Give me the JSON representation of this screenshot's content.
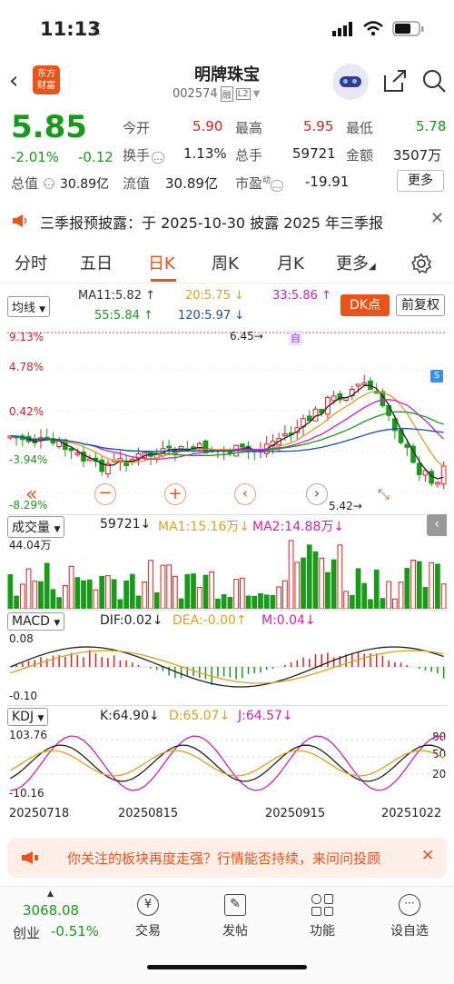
{
  "status": {
    "time": "11:13"
  },
  "header": {
    "brand": "东方\n财富",
    "title": "明牌珠宝",
    "code": "002574",
    "tag1": "融",
    "tag2": "L2"
  },
  "quote": {
    "price": "5.85",
    "pct": "-2.01%",
    "chg": "-0.12",
    "labels": {
      "open": "今开",
      "high": "最高",
      "low": "最低",
      "turnover": "换手",
      "volume": "总手",
      "amount": "金额",
      "mktcap": "总值",
      "float": "流值",
      "pe": "市盈"
    },
    "values": {
      "open": "5.90",
      "high": "5.95",
      "low": "5.78",
      "turnover": "1.13%",
      "volume": "59721",
      "amount": "3507万",
      "mktcap": "30.89亿",
      "float": "30.89亿",
      "pe": "-19.91"
    },
    "more": "更多"
  },
  "notice": {
    "text": "三季报预披露：于 2025-10-30 披露 2025 年三季报"
  },
  "tabs": [
    "分时",
    "五日",
    "日K",
    "周K",
    "月K",
    "更多"
  ],
  "kline": {
    "ma_select": "均线",
    "ma11": "MA11:5.82 ↑",
    "ma20": "20:5.75 ↓",
    "ma33": "33:5.86 ↑",
    "ma55": "55:5.84 ↑",
    "ma120": "120:5.97 ↓",
    "dk": "DK点",
    "adj": "前复权",
    "pct_top": "9.13%",
    "pct_2": "4.78%",
    "pct_3": "0.42%",
    "pct_4": "-3.94%",
    "pct_5": "-8.29%",
    "high_mark": "6.45→",
    "low_mark": "5.42→",
    "marker_zi": "自",
    "marker_s": "S"
  },
  "volume": {
    "select": "成交量",
    "val": "59721↓",
    "ma1": "MA1:15.16万↓",
    "ma2": "MA2:14.88万↓",
    "top": "44.04万"
  },
  "macd": {
    "select": "MACD",
    "dif": "DIF:0.02↓",
    "dea": "DEA:-0.00↑",
    "m": "M:0.04↓",
    "top": "0.08",
    "bottom": "-0.10"
  },
  "kdj": {
    "select": "KDJ",
    "k": "K:64.90↓",
    "d": "D:65.07↓",
    "j": "J:64.57↓",
    "top": "103.76",
    "bottom": "-10.16",
    "r80": "80",
    "r50": "50",
    "r20": "20"
  },
  "dates": [
    "20250718",
    "20250815",
    "20250915",
    "20251022"
  ],
  "banner": {
    "text": "你关注的板块再度走强？行情能否持续，来问问投顾"
  },
  "bottom": {
    "index_val": "3068.08",
    "index_name": "创业",
    "index_pct": "-0.51%",
    "items": [
      "交易",
      "发帖",
      "功能",
      "设自选"
    ]
  },
  "colors": {
    "up": "#e02020",
    "down": "#1a9a1a",
    "accent": "#e8541a"
  }
}
